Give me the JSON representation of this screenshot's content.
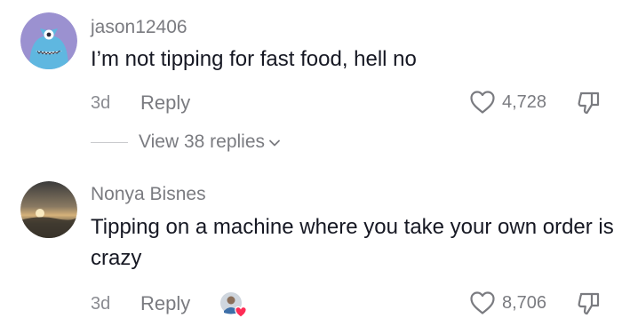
{
  "comments": [
    {
      "username": "jason12406",
      "text": "I’m not tipping for fast food, hell no",
      "time": "3d",
      "reply_label": "Reply",
      "likes": "4,728",
      "view_replies_label": "View 38 replies",
      "avatar_icon": "blue-monster-avatar-icon"
    },
    {
      "username": "Nonya Bisnes",
      "text": "Tipping on a machine where you take your own order is crazy",
      "time": "3d",
      "reply_label": "Reply",
      "likes": "8,706",
      "avatar_icon": "sunset-beach-avatar-icon",
      "creator_liked_icon": "creator-liked-heart-icon"
    }
  ],
  "colors": {
    "primary_text": "#161823",
    "secondary_text": "#7a7b80",
    "heart_red": "#fe2c55",
    "monster_bg": "#9b91d0",
    "monster_body": "#5fb7e0"
  }
}
